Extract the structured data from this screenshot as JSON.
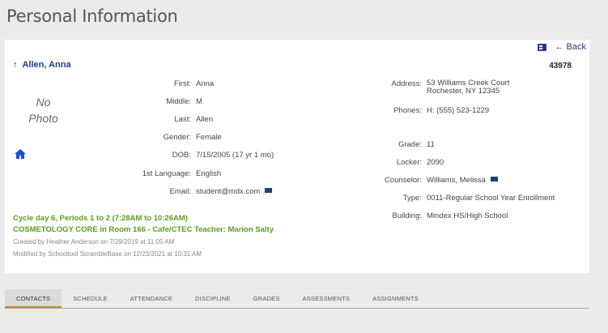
{
  "page": {
    "title": "Personal Information"
  },
  "header": {
    "back_label": "← Back",
    "student_id": "43978",
    "student_name": "Allen, Anna",
    "up_arrow": "↑"
  },
  "photo": {
    "placeholder_line1": "No",
    "placeholder_line2": "Photo"
  },
  "left": {
    "first_label": "First:",
    "first_value": "Anna",
    "middle_label": "Middle:",
    "middle_value": "M",
    "last_label": "Last:",
    "last_value": "Allen",
    "gender_label": "Gender:",
    "gender_value": "Female",
    "dob_label": "DOB:",
    "dob_value": "7/15/2005 (17 yr 1 mo)",
    "language_label": "1st Language:",
    "language_value": "English",
    "email_label": "Email:",
    "email_value": "student@mdx.com"
  },
  "right": {
    "address_label": "Address:",
    "address_line1": "53 Williams Creek Court",
    "address_line2": "Rochester, NY 12345",
    "phones_label": "Phones:",
    "phones_value": "H:  (555) 523-1229",
    "grade_label": "Grade:",
    "grade_value": "11",
    "locker_label": "Locker:",
    "locker_value": "2090",
    "counselor_label": "Counselor:",
    "counselor_value": "Williams, Melissa",
    "type_label": "Type:",
    "type_value": "0011-Regular School Year Enrollment",
    "building_label": "Building:",
    "building_value": "Mindex HS/High School"
  },
  "schedule": {
    "cycle": "Cycle day 6, Periods 1 to 2 (7:28AM to 10:26AM)",
    "course": "COSMETOLOGY CORE in Room 166 - Cafe/CTEC Teacher: Marion Salty",
    "created": "Created by Heather Anderson on 7/29/2019 at 11:05 AM",
    "modified": "Modified by Schooltool ScrambleBase on 12/23/2021 at 10:31 AM"
  },
  "tabs": [
    "CONTACTS",
    "SCHEDULE",
    "ATTENDANCE",
    "DISCIPLINE",
    "GRADES",
    "ASSESSMENTS",
    "ASSIGNMENTS"
  ],
  "colors": {
    "accent": "#c98a2a",
    "link": "#1f3f7a",
    "green": "#5a9c21"
  },
  "icons": {
    "id_card": "id-card-icon",
    "mail": "mail-icon",
    "home": "home-icon",
    "back": "back-arrow-icon"
  }
}
